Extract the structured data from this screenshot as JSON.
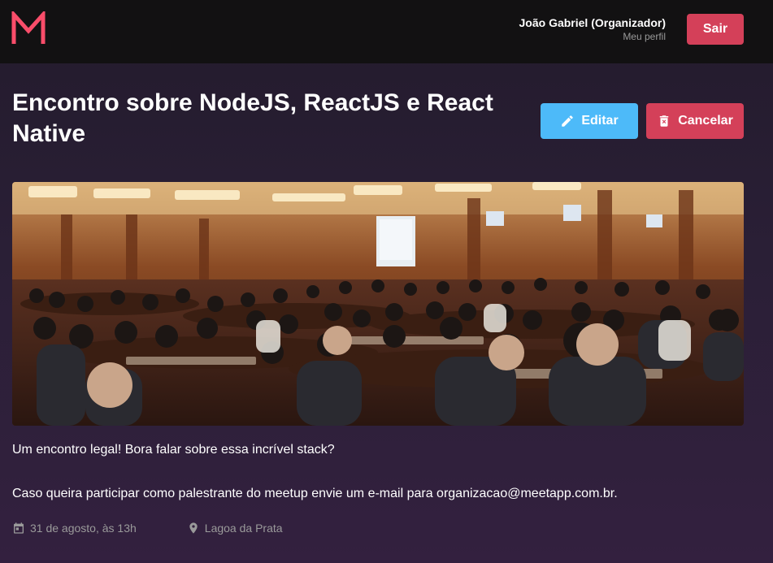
{
  "header": {
    "logo": "M",
    "user_name": "João Gabriel (Organizador)",
    "profile_link": "Meu perfil",
    "logout_label": "Sair"
  },
  "meetup": {
    "title": "Encontro sobre NodeJS, ReactJS e React Native",
    "edit_label": "Editar",
    "cancel_label": "Cancelar",
    "banner_alt": "conference-hall-photo",
    "description": [
      "Um encontro legal! Bora falar sobre essa incrível stack?",
      "Caso queira participar como palestrante do meetup envie um e-mail para organizacao@meetapp.com.br."
    ],
    "date": "31 de agosto, às 13h",
    "location": "Lagoa da Prata"
  },
  "colors": {
    "accent": "#f94d6a",
    "danger": "#d44059",
    "info": "#4dbaf9",
    "header_bg": "#121112"
  },
  "icons": {
    "edit": "pencil-icon",
    "cancel": "trash-icon",
    "date": "calendar-icon",
    "location": "map-pin-icon"
  }
}
